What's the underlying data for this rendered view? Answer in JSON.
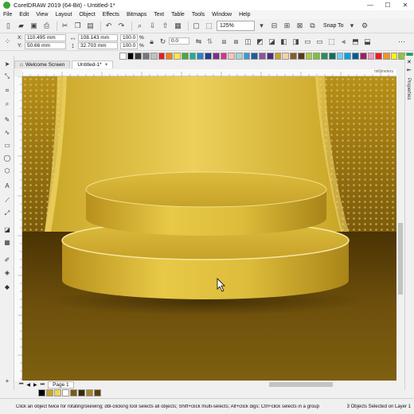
{
  "window": {
    "title": "CorelDRAW 2019 (64-Bit) - Untitled-1*",
    "minimize": "—",
    "maximize": "☐",
    "close": "✕"
  },
  "menu": [
    "File",
    "Edit",
    "View",
    "Layout",
    "Object",
    "Effects",
    "Bitmaps",
    "Text",
    "Table",
    "Tools",
    "Window",
    "Help"
  ],
  "toolbar": {
    "zoom": "125%",
    "snap_to": "Snap To"
  },
  "properties": {
    "x": "110.495 mm",
    "y": "50.66 mm",
    "width": "108.143 mm",
    "height": "32.703 mm",
    "scale_w": "100.0",
    "scale_h": "100.0",
    "scale_unit": "%",
    "rotation": "0.0",
    "x_label": "X:",
    "y_label": "Y:"
  },
  "tabs": {
    "welcome": "Welcome Screen",
    "doc": "Untitled-1*"
  },
  "ruler": {
    "unit": "millimeters"
  },
  "docker": {
    "label": "Properties"
  },
  "pages": {
    "tab": "Page 1"
  },
  "status": {
    "message": "Click an object twice for rotating/skewing; dbl-clicking tool selects all objects; Shift+click multi-selects; Alt+click digs; Ctrl+click selects in a group",
    "selection": "3 Objects Selected on Layer 1"
  },
  "palette_colors": [
    "#ffffff",
    "#000000",
    "#3b3b3b",
    "#777777",
    "#c0c0c0",
    "#e31e24",
    "#ee7d22",
    "#fbe74b",
    "#49a942",
    "#1eae96",
    "#2b82c9",
    "#1d3f8f",
    "#7b2f8c",
    "#d6338d",
    "#f4c3c5",
    "#a1d7d3",
    "#3a9ad9",
    "#1f5d9c",
    "#8e52a1",
    "#4b2e83",
    "#c9a227",
    "#f2d2a9",
    "#8b5a2b",
    "#5b3a1a",
    "#a7cf3c",
    "#7ac143",
    "#2e8b57",
    "#0f6f5c",
    "#6dcff6",
    "#00a4e4",
    "#005b96",
    "#9e1f63",
    "#f49ac1",
    "#ed1c24",
    "#f7941d",
    "#fff200",
    "#8dc63f",
    "#00a651"
  ],
  "doc_palette_colors": [
    "#000000",
    "#c9a227",
    "#f1d35b",
    "#ffffff",
    "#7a5a14",
    "#3a2a08",
    "#a88420",
    "#5b3e0b"
  ],
  "icons": {
    "select": "arrow-cursor",
    "shape": "node-tool",
    "crop": "crop-tool",
    "zoom": "magnifier",
    "freehand": "curve-tool",
    "rect": "rectangle-tool",
    "ellipse": "ellipse-tool",
    "polygon": "polygon-tool",
    "text": "text-tool",
    "line": "connector-tool",
    "fill": "fill-tool",
    "eyedropper": "eyedropper-tool"
  }
}
